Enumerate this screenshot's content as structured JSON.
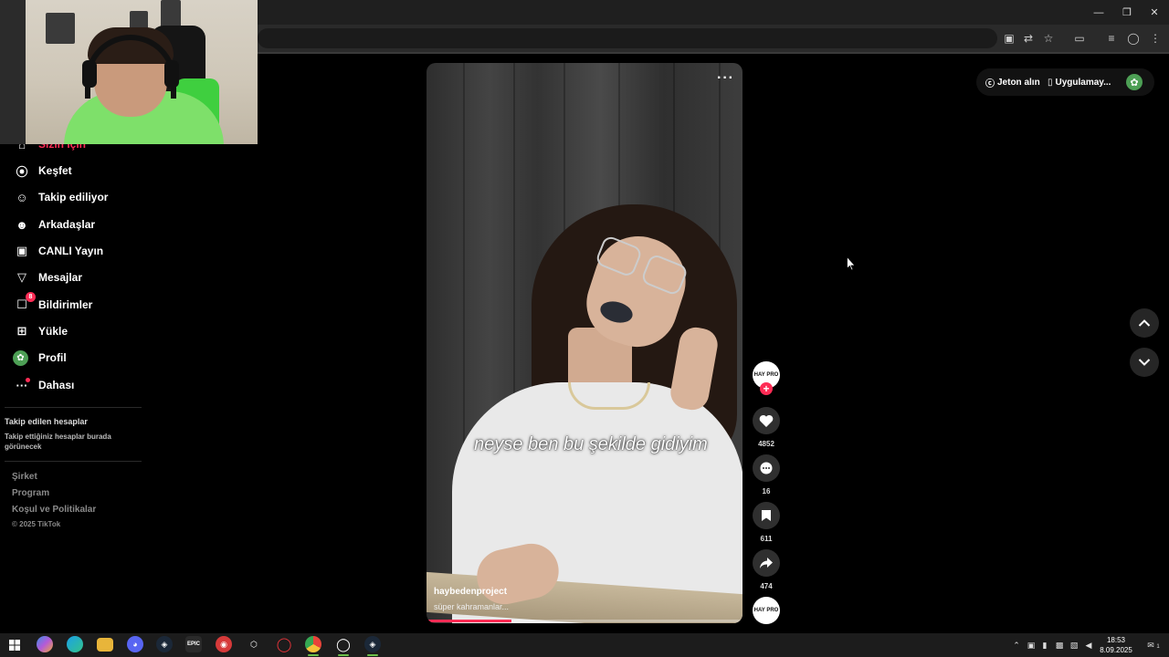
{
  "sidebar": {
    "items": [
      {
        "label": "Sizin için",
        "icon": "home-icon"
      },
      {
        "label": "Keşfet",
        "icon": "compass-icon"
      },
      {
        "label": "Takip ediliyor",
        "icon": "following-icon"
      },
      {
        "label": "Arkadaşlar",
        "icon": "friends-icon"
      },
      {
        "label": "CANLI Yayın",
        "icon": "live-icon"
      },
      {
        "label": "Mesajlar",
        "icon": "send-icon"
      },
      {
        "label": "Bildirimler",
        "icon": "inbox-icon",
        "badge": "8"
      },
      {
        "label": "Yükle",
        "icon": "upload-icon"
      },
      {
        "label": "Profil",
        "icon": "profile-avatar-icon"
      },
      {
        "label": "Dahası",
        "icon": "more-icon"
      }
    ],
    "following_title": "Takip edilen hesaplar",
    "following_desc": "Takip ettiğiniz hesaplar burada görünecek",
    "footer_links": [
      "Şirket",
      "Program",
      "Koşul ve Politikalar"
    ],
    "copyright": "© 2025 TikTok"
  },
  "video": {
    "caption": "neyse ben bu şekilde gidiyim",
    "author": "haybedenproject",
    "description": "süper kahramanlar...",
    "more_label": "···",
    "progress": 0.27
  },
  "actions": {
    "avatar_text": "HAY PRO",
    "likes": "4852",
    "comments": "16",
    "saves": "611",
    "shares": "474"
  },
  "topbar": {
    "coins_label": "Jeton alın",
    "app_label": "Uygulamay..."
  },
  "taskbar": {
    "time": "18:53",
    "date": "8.09.2025",
    "notification_count": "1"
  },
  "colors": {
    "accent": "#fe2c55",
    "background": "#000000",
    "taskbar": "#1c1c1c"
  }
}
